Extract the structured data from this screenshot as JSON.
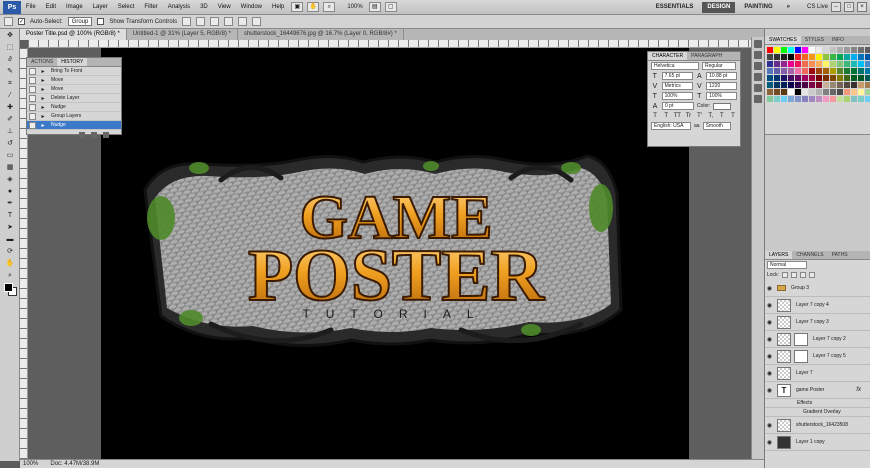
{
  "app": {
    "logo": "Ps"
  },
  "menu": [
    "File",
    "Edit",
    "Image",
    "Layer",
    "Select",
    "Filter",
    "Analysis",
    "3D",
    "View",
    "Window",
    "Help"
  ],
  "zoom_menu": "100%",
  "workspaces": [
    "ESSENTIALS",
    "DESIGN",
    "PAINTING"
  ],
  "active_workspace": "DESIGN",
  "more": "»",
  "cs_live": "CS Live",
  "options": {
    "auto_select_label": "Auto-Select:",
    "auto_select_value": "Group",
    "transform_label": "Show Transform Controls"
  },
  "tabs": [
    "Poster Title.psd @ 100% (RGB/8) *",
    "Untitled-1 @ 31% (Layer 5, RGB/8) *",
    "shutterstock_16449676.jpg @ 16.7% (Layer 0, RGB/8#) *"
  ],
  "history_panel": {
    "tabs": [
      "ACTIONS",
      "HISTORY"
    ],
    "rows": [
      "Bring To Front",
      "Move",
      "Move",
      "Delete Layer",
      "Nudge",
      "Group Layers",
      "Nudge"
    ]
  },
  "artwork": {
    "line1": "GAME",
    "line2": "POSTER",
    "line3": "TUTORIAL"
  },
  "status": {
    "zoom": "100%",
    "doc": "Doc: 4.47M/38.9M"
  },
  "character_panel": {
    "tabs": [
      "CHARACTER",
      "PARAGRAPH"
    ],
    "font_family": "Helvetica",
    "font_style": "Regular",
    "size": "7.65 pt",
    "leading": "10.88 pt",
    "kerning": "Metrics",
    "tracking": "1220",
    "vscale": "100%",
    "hscale": "100%",
    "baseline": "0 pt",
    "color_label": "Color:",
    "glyph_buttons": [
      "T",
      "T",
      "TT",
      "Tr",
      "T'",
      "T,",
      "T",
      "T"
    ],
    "language": "English: USA",
    "antialias": "Smooth",
    "aa_label": "aa"
  },
  "swatches_panel": {
    "tabs": [
      "SWATCHES",
      "STYLES",
      "INFO"
    ],
    "colors": [
      "#ff0000",
      "#ffff00",
      "#00ff00",
      "#00ffff",
      "#0000ff",
      "#ff00ff",
      "#ffffff",
      "#ebebeb",
      "#d6d6d6",
      "#c2c2c2",
      "#adadad",
      "#999999",
      "#858585",
      "#707070",
      "#5c5c5c",
      "#474747",
      "#333333",
      "#1f1f1f",
      "#000000",
      "#ed1c24",
      "#f26522",
      "#f7941d",
      "#fff200",
      "#8dc63f",
      "#39b54a",
      "#00a651",
      "#00a99d",
      "#00aeef",
      "#0072bc",
      "#0054a6",
      "#2e3192",
      "#662d91",
      "#92278f",
      "#ec008c",
      "#ed145b",
      "#f26c4f",
      "#f68e56",
      "#fbaf5d",
      "#fff568",
      "#acd373",
      "#7cc576",
      "#3bb878",
      "#1abbb4",
      "#00bff3",
      "#438ccb",
      "#5674b9",
      "#605ca8",
      "#855fa8",
      "#a763a8",
      "#f06eaa",
      "#f0685d",
      "#9e0b0f",
      "#a0410d",
      "#a36209",
      "#aba000",
      "#598527",
      "#1a7b30",
      "#007236",
      "#00746b",
      "#0076a3",
      "#004b80",
      "#003471",
      "#1b1464",
      "#440e62",
      "#630460",
      "#9e005d",
      "#9e0039",
      "#790000",
      "#7b2e00",
      "#7d4900",
      "#827b00",
      "#406618",
      "#005e20",
      "#005826",
      "#005952",
      "#005b7f",
      "#003663",
      "#002157",
      "#0d004c",
      "#32004b",
      "#4b0049",
      "#7b0046",
      "#7a0026",
      "#c7b299",
      "#998675",
      "#736357",
      "#534741",
      "#37302d",
      "#c69c6d",
      "#a67c52",
      "#8c6239",
      "#754c24",
      "#603913",
      "#ffffff",
      "#000000",
      "#e6e6e6",
      "#cccccc",
      "#b3b3b3",
      "#808080",
      "#666666",
      "#4d4d4d",
      "#f7977a",
      "#fdc68a",
      "#fff79a",
      "#a2d39c",
      "#82ca9d",
      "#7bcdc8",
      "#6ecff6",
      "#7ea7d8",
      "#8493ca",
      "#8882be",
      "#a187be",
      "#bc8dbf",
      "#f49ac2",
      "#f6989d",
      "#c4df9b",
      "#acd373",
      "#84c2c1",
      "#7accc8",
      "#6dcff6"
    ]
  },
  "layers_panel": {
    "tabs": [
      "LAYERS",
      "CHANNELS",
      "PATHS"
    ],
    "blend_mode": "Normal",
    "lock_label": "Lock:",
    "rows": [
      {
        "name": "Group 3",
        "kind": "group"
      },
      {
        "name": "Layer 7 copy 4",
        "kind": "pixel"
      },
      {
        "name": "Layer 7 copy 3",
        "kind": "pixel"
      },
      {
        "name": "Layer 7 copy 2",
        "kind": "masked"
      },
      {
        "name": "Layer 7 copy 5",
        "kind": "masked"
      },
      {
        "name": "Layer 7",
        "kind": "pixel"
      },
      {
        "name": "game Poster",
        "kind": "text",
        "fx": "fx"
      },
      {
        "name": "Effects",
        "kind": "effects"
      },
      {
        "name": "Gradient Overlay",
        "kind": "effect"
      },
      {
        "name": "shutterstock_16423508",
        "kind": "pixel"
      },
      {
        "name": "Layer 1 copy",
        "kind": "dark"
      }
    ]
  },
  "icons": {
    "eye": "eye-icon",
    "move": "move-tool-icon",
    "history_step": "history-step-icon",
    "text_layer": "text-layer-icon"
  }
}
